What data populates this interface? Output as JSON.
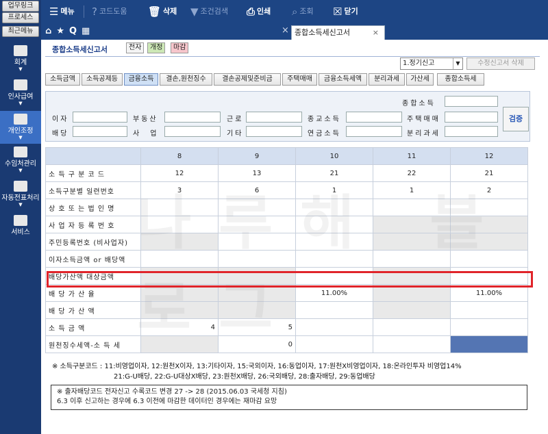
{
  "quick": [
    "업무링크",
    "프로세스",
    "최근메뉴"
  ],
  "toolbar": {
    "menu": "메뉴",
    "help": "코드도움",
    "delete": "삭제",
    "filter": "조건검색",
    "print": "인쇄",
    "search": "조회",
    "close": "닫기"
  },
  "sidebar": [
    {
      "label": "회계",
      "icon": "calculator-icon"
    },
    {
      "label": "인사급여",
      "icon": "people-icon"
    },
    {
      "label": "개인조정",
      "icon": "person-icon",
      "active": true
    },
    {
      "label": "수임처관리",
      "icon": "org-icon"
    },
    {
      "label": "자동전표처리",
      "icon": "database-icon"
    },
    {
      "label": "서비스",
      "icon": "monitor-icon"
    }
  ],
  "tab": {
    "active": "종합소득세신고서"
  },
  "page": {
    "title": "종합소득세신고서",
    "badges": [
      "전자",
      "개정",
      "마감"
    ],
    "select_value": "1.정기신고",
    "delete_btn": "수정신고서 삭제",
    "subtabs": [
      "소득금액",
      "소득공제등",
      "금융소득",
      "결손,원천징수",
      "결손공제및준비금",
      "주택매매",
      "금융소득세액",
      "분리과세",
      "가산세",
      "종합소득세"
    ]
  },
  "filter": {
    "total_income": "종합소득",
    "interest": "이자",
    "dividend": "배당",
    "realestate": "부동산",
    "business": "사업",
    "labor": "근로",
    "other": "기타",
    "stock": "종교소득",
    "pension": "연금소득",
    "house": "주택매매",
    "separate": "분리과세",
    "check": "검증"
  },
  "grid": {
    "columns": [
      "8",
      "9",
      "10",
      "11",
      "12"
    ],
    "rows": [
      {
        "label": "소 득 구 분 코 드",
        "values": [
          "12",
          "13",
          "21",
          "22",
          "21"
        ]
      },
      {
        "label": "소득구분별 일련번호",
        "values": [
          "3",
          "6",
          "1",
          "1",
          "2"
        ]
      },
      {
        "label": "상 호 또 는 법 인 명",
        "values": [
          "",
          "",
          "",
          "",
          ""
        ]
      },
      {
        "label": "사 업 자 등 록 번 호",
        "values": [
          "",
          "",
          "",
          "",
          ""
        ]
      },
      {
        "label": "주민등록번호 (비사업자)",
        "values": [
          "",
          "",
          "",
          "",
          ""
        ]
      },
      {
        "label": "이자소득금액 or 배당액",
        "values": [
          "",
          "",
          "",
          "",
          ""
        ]
      },
      {
        "label": "배당가산액 대상금액",
        "values": [
          "",
          "",
          "",
          "",
          ""
        ]
      },
      {
        "label": "배 당 가 산 율",
        "values": [
          "",
          "",
          "11.00%",
          "",
          "11.00%"
        ]
      },
      {
        "label": "배 당 가 산 액",
        "values": [
          "",
          "",
          "",
          "",
          ""
        ]
      },
      {
        "label": "소 득 금 액",
        "values": [
          "4",
          "5",
          "",
          "",
          ""
        ]
      },
      {
        "label": "원천징수세액-소 득 세",
        "values": [
          "",
          "0",
          "",
          "",
          ""
        ]
      }
    ]
  },
  "notes": {
    "line1": "※ 소득구분코드 : 11:비영업이자, 12:원천X이자, 13:기타이자, 15:국외이자, 16:동업이자, 17:원천X비영업이자, 18:온라인투자 비영업14%",
    "line2": "21:G-U배당, 22:G-U대상X배당, 23:원천X배당, 26:국외배당, 28:출자배당, 29:동업배당",
    "box1": "※ 출자배당코드 전자신고 수록코드 변경 27 -> 28 (2015.06.03 국세청 지침)",
    "box2": "6.3 이후 신고하는 경우에 6.3 이전에 마감한 데이터인 경우에는 재마감 요망"
  },
  "watermark": "나루해 블로그"
}
